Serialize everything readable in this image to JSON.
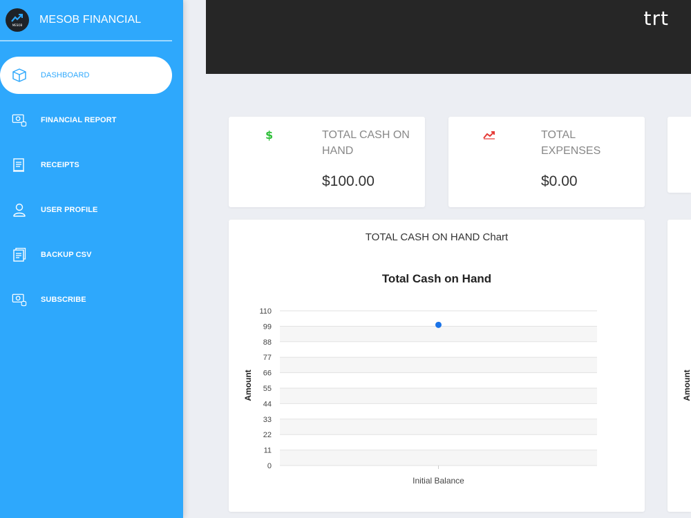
{
  "sidebar": {
    "brand": "MESOB FINANCIAL",
    "logo_text": "MESOB",
    "items": [
      {
        "label": "DASHBOARD",
        "icon": "box-icon"
      },
      {
        "label": "FINANCIAL REPORT",
        "icon": "money-report-icon"
      },
      {
        "label": "RECEIPTS",
        "icon": "receipt-icon"
      },
      {
        "label": "USER PROFILE",
        "icon": "user-icon"
      },
      {
        "label": "BACKUP CSV",
        "icon": "document-icon"
      },
      {
        "label": "SUBSCRIBE",
        "icon": "money-subscribe-icon"
      }
    ]
  },
  "header": {
    "user": "trt"
  },
  "stats": [
    {
      "title": "TOTAL CASH ON HAND",
      "value": "$100.00",
      "icon": "dollar-icon",
      "color": "#2fbf3a"
    },
    {
      "title": "TOTAL EXPENSES",
      "value": "$0.00",
      "icon": "trend-icon",
      "color": "#e53935"
    }
  ],
  "chart_card": {
    "title": "TOTAL CASH ON HAND Chart"
  },
  "chart_data": {
    "type": "scatter",
    "title": "Total Cash on Hand",
    "xlabel": "",
    "ylabel": "Amount",
    "categories": [
      "Initial Balance"
    ],
    "values": [
      100
    ],
    "ylim": [
      0,
      110
    ],
    "yticks": [
      0,
      11,
      22,
      33,
      44,
      55,
      66,
      77,
      88,
      99,
      110
    ],
    "color": "#1a73e8"
  },
  "partial_chart": {
    "ylabel": "Amount"
  },
  "colors": {
    "sidebar": "#2ea8fc",
    "header": "#262626",
    "background": "#eceef3"
  }
}
